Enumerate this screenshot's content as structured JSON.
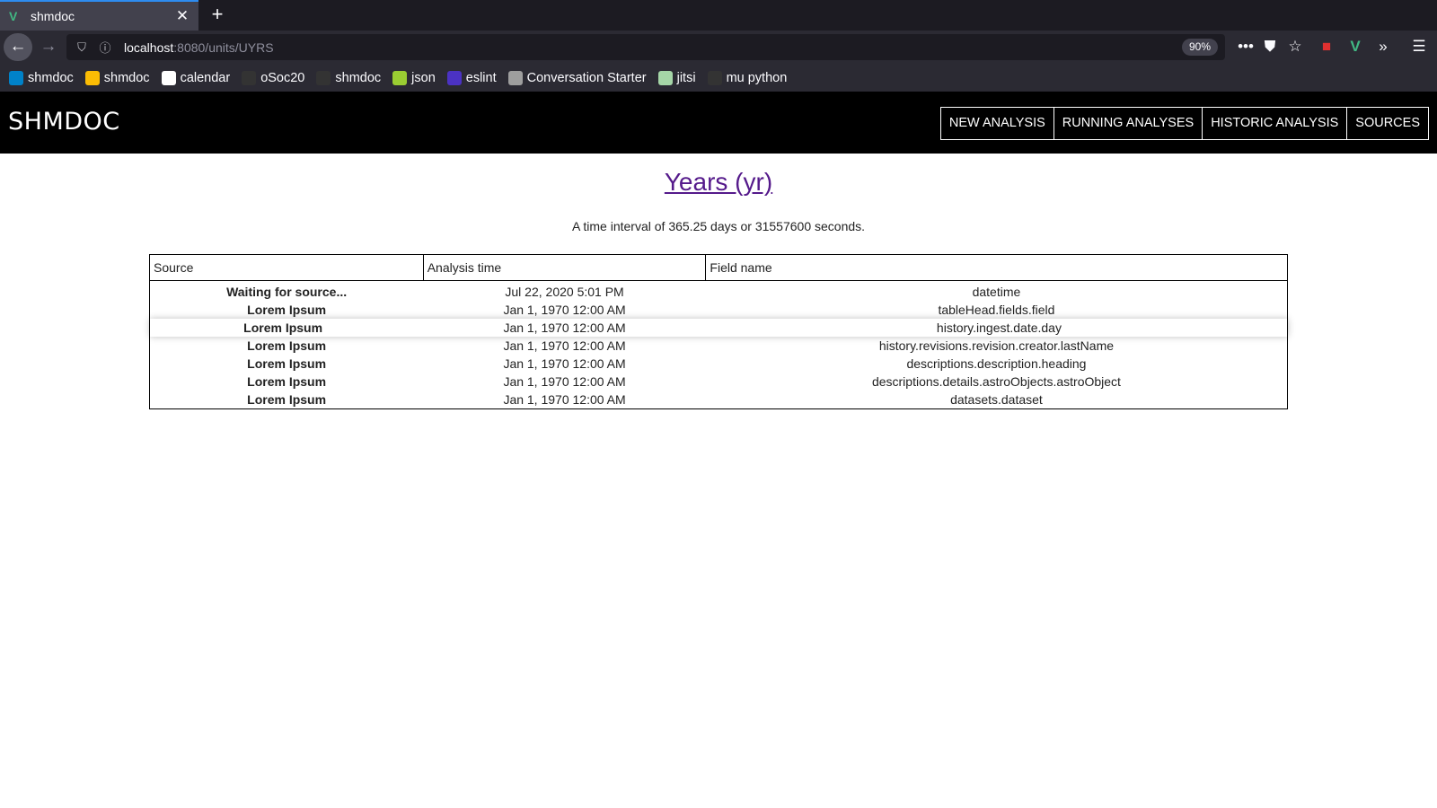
{
  "browser": {
    "tab_title": "shmdoc",
    "url_host": "localhost",
    "url_rest": ":8080/units/UYRS",
    "zoom": "90%",
    "bookmarks": [
      {
        "label": "shmdoc",
        "icon": "nextcloud-icon",
        "color": "#0082c9"
      },
      {
        "label": "shmdoc",
        "icon": "drive-icon",
        "color": "#fbbc04"
      },
      {
        "label": "calendar",
        "icon": "calendar-icon",
        "color": "#ffffff"
      },
      {
        "label": "oSoc20",
        "icon": "github-icon",
        "color": "#333333"
      },
      {
        "label": "shmdoc",
        "icon": "github-icon",
        "color": "#333333"
      },
      {
        "label": "json",
        "icon": "json-icon",
        "color": "#9acd32"
      },
      {
        "label": "eslint",
        "icon": "eslint-icon",
        "color": "#4b32c3"
      },
      {
        "label": "Conversation Starter",
        "icon": "globe-icon",
        "color": "#9e9e9e"
      },
      {
        "label": "jitsi",
        "icon": "jitsi-icon",
        "color": "#a5d6a7"
      },
      {
        "label": "mu python",
        "icon": "github-icon",
        "color": "#333333"
      }
    ]
  },
  "app": {
    "title": "SHMDOC",
    "nav": [
      "NEW ANALYSIS",
      "RUNNING ANALYSES",
      "HISTORIC ANALYSIS",
      "SOURCES"
    ]
  },
  "unit": {
    "title": "Years (yr)",
    "description": "A time interval of 365.25 days or 31557600 seconds."
  },
  "table": {
    "headers": [
      "Source",
      "Analysis time",
      "Field name"
    ],
    "rows": [
      {
        "source": "Waiting for source...",
        "time": "Jul 22, 2020 5:01 PM",
        "field": "datetime"
      },
      {
        "source": "Lorem Ipsum",
        "time": "Jan 1, 1970 12:00 AM",
        "field": "tableHead.fields.field"
      },
      {
        "source": "Lorem Ipsum",
        "time": "Jan 1, 1970 12:00 AM",
        "field": "history.ingest.date.day"
      },
      {
        "source": "Lorem Ipsum",
        "time": "Jan 1, 1970 12:00 AM",
        "field": "history.revisions.revision.creator.lastName"
      },
      {
        "source": "Lorem Ipsum",
        "time": "Jan 1, 1970 12:00 AM",
        "field": "descriptions.description.heading"
      },
      {
        "source": "Lorem Ipsum",
        "time": "Jan 1, 1970 12:00 AM",
        "field": "descriptions.details.astroObjects.astroObject"
      },
      {
        "source": "Lorem Ipsum",
        "time": "Jan 1, 1970 12:00 AM",
        "field": "datasets.dataset"
      }
    ]
  }
}
